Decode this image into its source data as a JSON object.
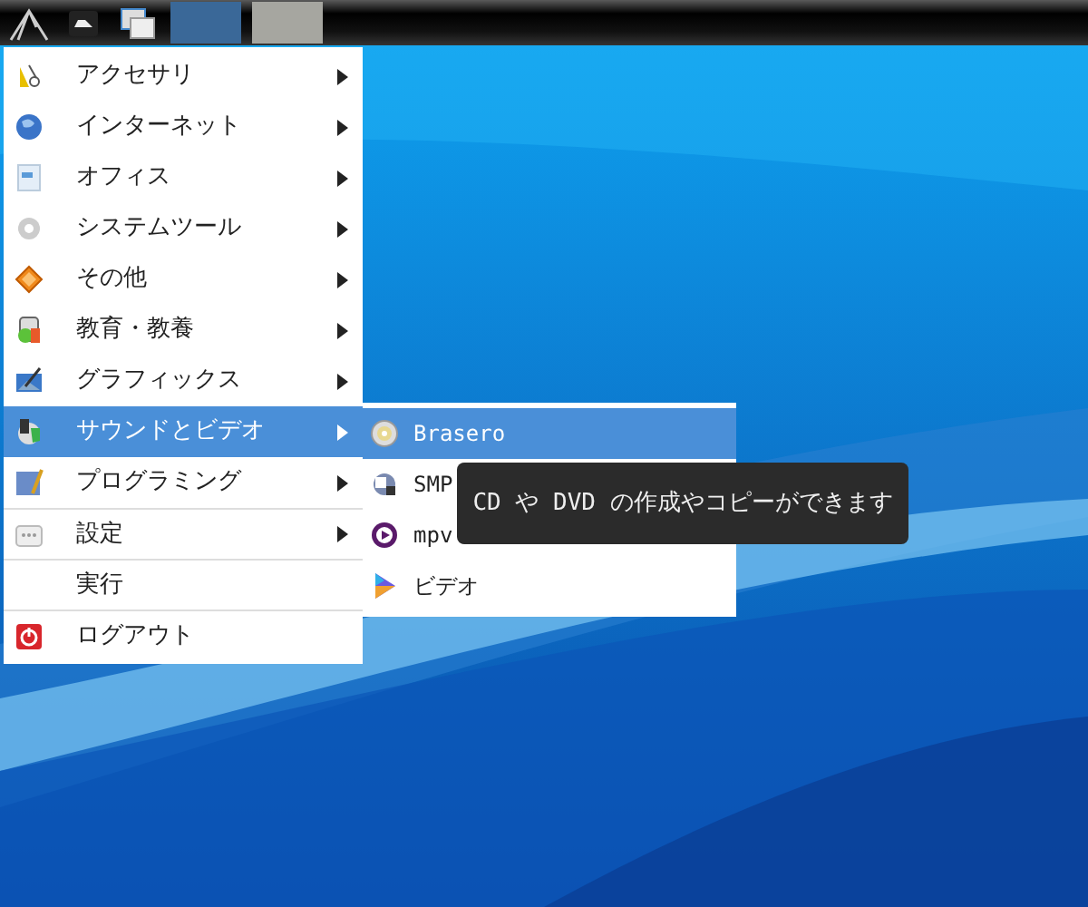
{
  "taskbar": {
    "workspaces": [
      {
        "selected": true
      },
      {
        "selected": false
      }
    ]
  },
  "menu": {
    "items": [
      {
        "label": "アクセサリ",
        "submenu": true,
        "selected": false,
        "separator_before": false
      },
      {
        "label": "インターネット",
        "submenu": true,
        "selected": false,
        "separator_before": false
      },
      {
        "label": "オフィス",
        "submenu": true,
        "selected": false,
        "separator_before": false
      },
      {
        "label": "システムツール",
        "submenu": true,
        "selected": false,
        "separator_before": false
      },
      {
        "label": "その他",
        "submenu": true,
        "selected": false,
        "separator_before": false
      },
      {
        "label": "教育・教養",
        "submenu": true,
        "selected": false,
        "separator_before": false
      },
      {
        "label": "グラフィックス",
        "submenu": true,
        "selected": false,
        "separator_before": false
      },
      {
        "label": "サウンドとビデオ",
        "submenu": true,
        "selected": true,
        "separator_before": false
      },
      {
        "label": "プログラミング",
        "submenu": true,
        "selected": false,
        "separator_before": false
      },
      {
        "label": "設定",
        "submenu": true,
        "selected": false,
        "separator_before": true
      },
      {
        "label": "実行",
        "submenu": false,
        "selected": false,
        "separator_before": true
      },
      {
        "label": "ログアウト",
        "submenu": false,
        "selected": false,
        "separator_before": true
      }
    ]
  },
  "submenu": {
    "items": [
      {
        "label": "Brasero",
        "selected": true
      },
      {
        "label": "SMP",
        "selected": false
      },
      {
        "label": "mpv",
        "selected": false
      },
      {
        "label": "ビデオ",
        "selected": false
      }
    ]
  },
  "tooltip": {
    "text": "CD や DVD の作成やコピーができます"
  }
}
